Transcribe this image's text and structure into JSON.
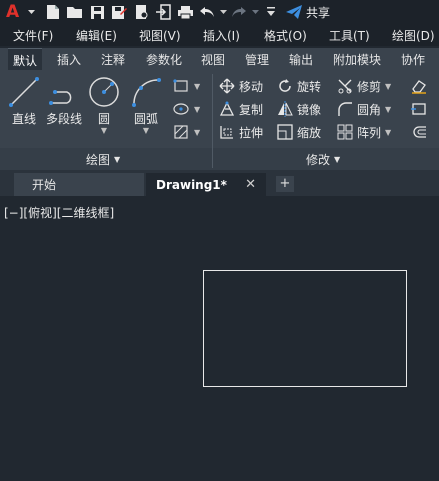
{
  "app": {
    "logo_letter": "A",
    "share_label": "共享"
  },
  "quick_access": [
    "new-icon",
    "open-icon",
    "save-icon",
    "save-as-icon",
    "plot-preview-icon",
    "import-icon",
    "print-icon",
    "undo-icon",
    "redo-icon",
    "customize-icon",
    "share-icon"
  ],
  "menubar": {
    "items": [
      "文件(F)",
      "编辑(E)",
      "视图(V)",
      "插入(I)",
      "格式(O)",
      "工具(T)",
      "绘图(D)"
    ]
  },
  "ribbon_tabs": {
    "items": [
      "默认",
      "插入",
      "注释",
      "参数化",
      "视图",
      "管理",
      "输出",
      "附加模块",
      "协作"
    ],
    "active": "默认"
  },
  "draw_panel": {
    "title": "绘图",
    "line": "直线",
    "polyline": "多段线",
    "circle": "圆",
    "arc": "圆弧"
  },
  "modify_panel": {
    "title": "修改",
    "move": "移动",
    "rotate": "旋转",
    "trim": "修剪",
    "copy": "复制",
    "mirror": "镜像",
    "fillet": "圆角",
    "stretch": "拉伸",
    "scale": "缩放",
    "array": "阵列"
  },
  "doc_tabs": {
    "start": "开始",
    "active": "Drawing1*",
    "close_glyph": "✕",
    "add_glyph": "+"
  },
  "canvas": {
    "viewport_label": "[−][俯视][二维线框]"
  },
  "colors": {
    "accent_logo": "#e0312b",
    "share_blue": "#3d8fe0",
    "ribbon_bg": "#3a434d",
    "canvas_bg": "#212830"
  }
}
